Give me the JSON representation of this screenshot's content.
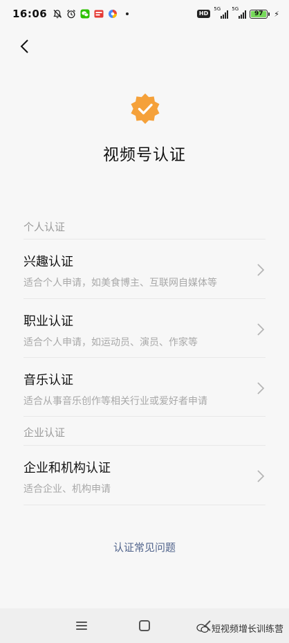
{
  "status_bar": {
    "time": "16:06",
    "network_tag_1": "5G",
    "network_tag_2": "5G",
    "hd": "HD",
    "battery": "97",
    "battery_level": 0.97,
    "icons": [
      "mute-bell-icon",
      "alarm-icon",
      "wechat-icon",
      "app-notification-icon",
      "browser-icon"
    ]
  },
  "header": {
    "title": "视频号认证",
    "badge_color": "#f5a13a"
  },
  "sections": [
    {
      "label": "个人认证",
      "items": [
        {
          "title": "兴趣认证",
          "desc": "适合个人申请，如美食博主、互联网自媒体等"
        },
        {
          "title": "职业认证",
          "desc": "适合个人申请，如运动员、演员、作家等"
        },
        {
          "title": "音乐认证",
          "desc": "适合从事音乐创作等相关行业或爱好者申请"
        }
      ]
    },
    {
      "label": "企业认证",
      "items": [
        {
          "title": "企业和机构认证",
          "desc": "适合企业、机构申请"
        }
      ]
    }
  ],
  "footer": {
    "faq_link": "认证常见问题",
    "link_color": "#51648c"
  },
  "watermark": {
    "text": "短视频增长训练营"
  }
}
